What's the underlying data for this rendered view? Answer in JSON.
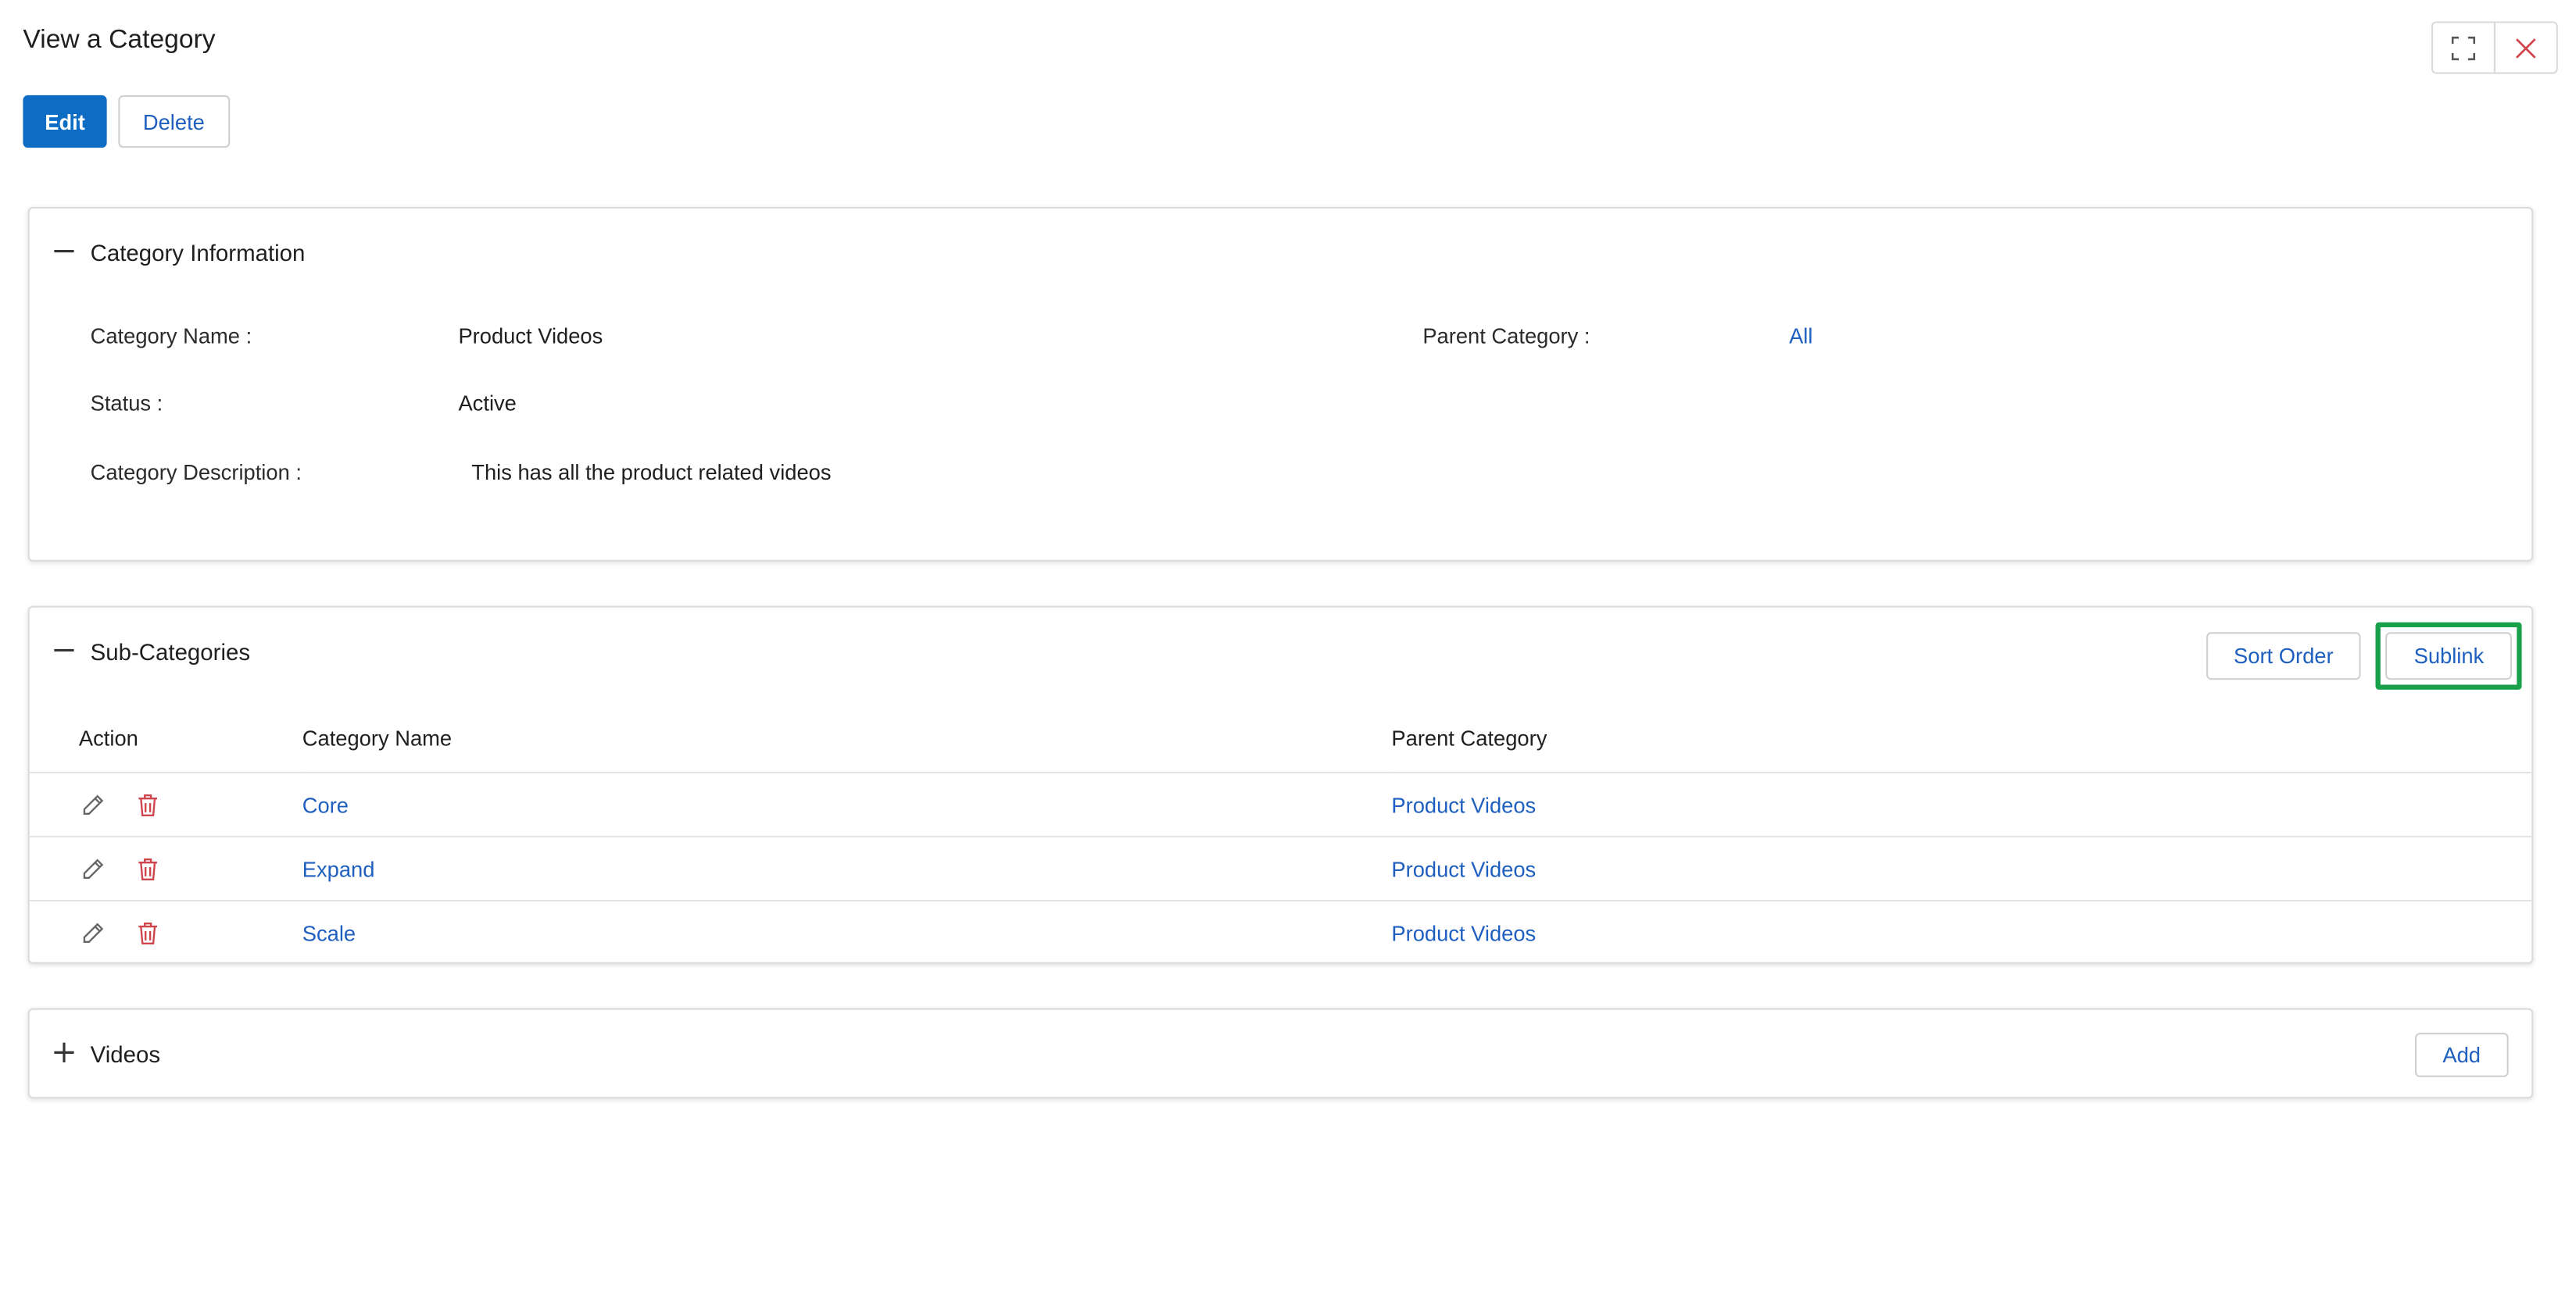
{
  "page": {
    "title": "View a Category"
  },
  "window_controls": {
    "expand_icon": "expand-icon",
    "close_icon": "close-icon"
  },
  "actions": {
    "edit_label": "Edit",
    "delete_label": "Delete"
  },
  "category_info": {
    "title": "Category Information",
    "toggle_icon": "minus-icon",
    "fields": {
      "name_label": "Category Name :",
      "name_value": "Product Videos",
      "parent_label": "Parent Category :",
      "parent_value": "All",
      "status_label": "Status :",
      "status_value": "Active",
      "description_label": "Category Description :",
      "description_value": "This has all the product related videos"
    }
  },
  "sub_categories": {
    "title": "Sub-Categories",
    "toggle_icon": "minus-icon",
    "sort_order_label": "Sort Order",
    "sublink_label": "Sublink",
    "columns": [
      "Action",
      "Category Name",
      "Parent Category"
    ],
    "rows": [
      {
        "name": "Core",
        "parent": "Product Videos"
      },
      {
        "name": "Expand",
        "parent": "Product Videos"
      },
      {
        "name": "Scale",
        "parent": "Product Videos"
      }
    ]
  },
  "videos": {
    "title": "Videos",
    "toggle_icon": "plus-icon",
    "add_label": "Add"
  },
  "colors": {
    "primary": "#0d6cc4",
    "link": "#1e5fbf",
    "danger": "#d0454c",
    "highlight": "#18a04a"
  }
}
